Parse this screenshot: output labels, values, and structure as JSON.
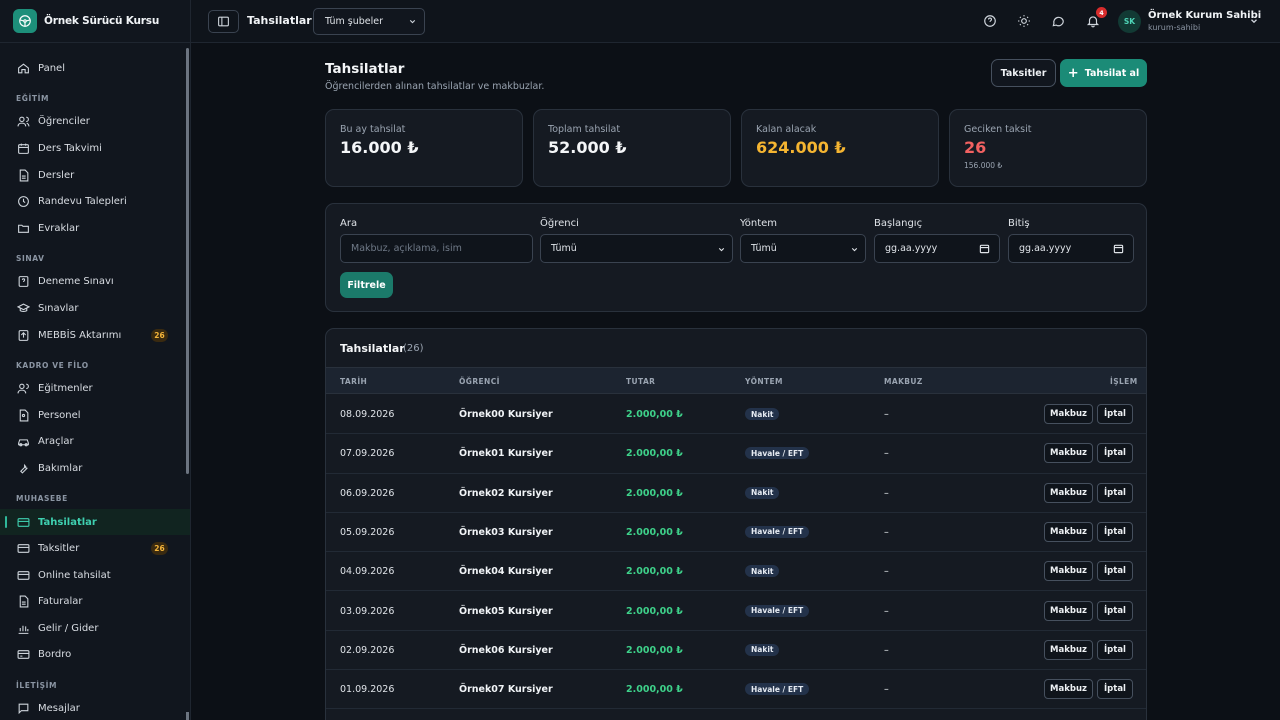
{
  "brand": {
    "name": "Örnek Sürücü Kursu"
  },
  "sidebar": {
    "panel": "Panel",
    "sections": [
      {
        "title": "EĞİTİM",
        "items": [
          {
            "label": "Öğrenciler"
          },
          {
            "label": "Ders Takvimi"
          },
          {
            "label": "Dersler"
          },
          {
            "label": "Randevu Talepleri"
          },
          {
            "label": "Evraklar"
          }
        ]
      },
      {
        "title": "SINAV",
        "items": [
          {
            "label": "Deneme Sınavı"
          },
          {
            "label": "Sınavlar"
          },
          {
            "label": "MEBBİS Aktarımı",
            "badge": "26"
          }
        ]
      },
      {
        "title": "KADRO VE FİLO",
        "items": [
          {
            "label": "Eğitmenler"
          },
          {
            "label": "Personel"
          },
          {
            "label": "Araçlar"
          },
          {
            "label": "Bakımlar"
          }
        ]
      },
      {
        "title": "MUHASEBE",
        "items": [
          {
            "label": "Tahsilatlar"
          },
          {
            "label": "Taksitler",
            "badge": "26"
          },
          {
            "label": "Online tahsilat"
          },
          {
            "label": "Faturalar"
          },
          {
            "label": "Gelir / Gider"
          },
          {
            "label": "Bordro"
          }
        ]
      },
      {
        "title": "İLETİŞİM",
        "items": [
          {
            "label": "Mesajlar"
          }
        ]
      }
    ]
  },
  "topbar": {
    "title": "Tahsilatlar",
    "branch": "Tüm şubeler",
    "notifications": "4",
    "avatar": "SK",
    "user_name": "Örnek Kurum Sahibi",
    "user_role": "kurum-sahibi"
  },
  "page": {
    "title": "Tahsilatlar",
    "subtitle": "Öğrencilerden alınan tahsilatlar ve makbuzlar.",
    "installments_btn": "Taksitler",
    "collect_btn": "Tahsilat al"
  },
  "stats": [
    {
      "label": "Bu ay tahsilat",
      "value": "16.000 ₺",
      "color": "#f4f6f8"
    },
    {
      "label": "Toplam tahsilat",
      "value": "52.000 ₺",
      "color": "#f4f6f8"
    },
    {
      "label": "Kalan alacak",
      "value": "624.000 ₺",
      "color": "#f5b531"
    },
    {
      "label": "Geciken taksit",
      "value": "26",
      "sub": "156.000 ₺",
      "color": "#f26161"
    }
  ],
  "filters": {
    "search_label": "Ara",
    "search_placeholder": "Makbuz, açıklama, isim",
    "student_label": "Öğrenci",
    "student_value": "Tümü",
    "method_label": "Yöntem",
    "method_value": "Tümü",
    "start_label": "Başlangıç",
    "start_value": "gg.aa.yyyy",
    "end_label": "Bitiş",
    "end_value": "gg.aa.yyyy",
    "filter_btn": "Filtrele"
  },
  "table": {
    "title": "Tahsilatlar",
    "count": "(26)",
    "headers": [
      "TARİH",
      "ÖĞRENCİ",
      "TUTAR",
      "YÖNTEM",
      "MAKBUZ",
      "İŞLEM"
    ],
    "receipt_btn": "Makbuz",
    "cancel_btn": "İptal",
    "rows": [
      {
        "date": "08.09.2026",
        "student": "Örnek00 Kursiyer",
        "amount": "2.000,00 ₺",
        "method": "Nakit",
        "receipt": "–"
      },
      {
        "date": "07.09.2026",
        "student": "Örnek01 Kursiyer",
        "amount": "2.000,00 ₺",
        "method": "Havale / EFT",
        "receipt": "–"
      },
      {
        "date": "06.09.2026",
        "student": "Örnek02 Kursiyer",
        "amount": "2.000,00 ₺",
        "method": "Nakit",
        "receipt": "–"
      },
      {
        "date": "05.09.2026",
        "student": "Örnek03 Kursiyer",
        "amount": "2.000,00 ₺",
        "method": "Havale / EFT",
        "receipt": "–"
      },
      {
        "date": "04.09.2026",
        "student": "Örnek04 Kursiyer",
        "amount": "2.000,00 ₺",
        "method": "Nakit",
        "receipt": "–"
      },
      {
        "date": "03.09.2026",
        "student": "Örnek05 Kursiyer",
        "amount": "2.000,00 ₺",
        "method": "Havale / EFT",
        "receipt": "–"
      },
      {
        "date": "02.09.2026",
        "student": "Örnek06 Kursiyer",
        "amount": "2.000,00 ₺",
        "method": "Nakit",
        "receipt": "–"
      },
      {
        "date": "01.09.2026",
        "student": "Örnek07 Kursiyer",
        "amount": "2.000,00 ₺",
        "method": "Havale / EFT",
        "receipt": "–"
      }
    ]
  }
}
